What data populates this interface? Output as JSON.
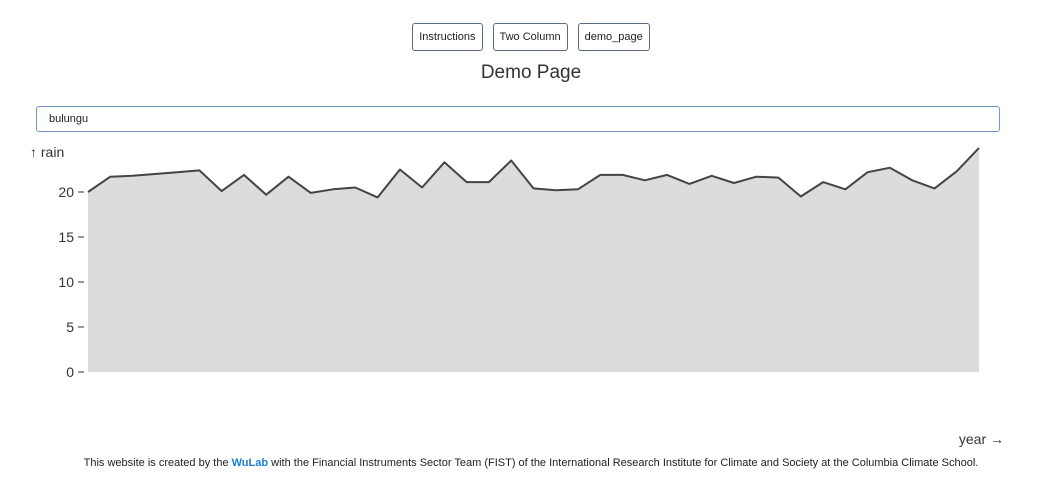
{
  "nav": {
    "items": [
      {
        "label": "Instructions"
      },
      {
        "label": "Two Column"
      },
      {
        "label": "demo_page"
      }
    ]
  },
  "page": {
    "title": "Demo Page"
  },
  "search": {
    "value": "bulungu"
  },
  "colors": {
    "area_fill": "#dcdcdc",
    "line": "#444444",
    "link": "#1a7fd6"
  },
  "chart_data": {
    "type": "area",
    "title": "",
    "ylabel": "↑ rain",
    "xlabel": "year →",
    "ylim": [
      0,
      25
    ],
    "yticks": [
      0,
      5,
      10,
      15,
      20
    ],
    "grid": false,
    "legend": "none",
    "series": [
      {
        "values": [
          20.0,
          21.7,
          21.8,
          22.0,
          22.2,
          22.4,
          20.1,
          21.9,
          19.7,
          21.7,
          19.9,
          20.3,
          20.5,
          19.4,
          22.5,
          20.5,
          23.3,
          21.1,
          21.1,
          23.5,
          20.4,
          20.2,
          20.3,
          21.9,
          21.9,
          21.3,
          21.9,
          20.9,
          21.8,
          21.0,
          21.7,
          21.6,
          19.5,
          21.1,
          20.3,
          22.2,
          22.7,
          21.3,
          20.4,
          22.3,
          24.9
        ]
      }
    ]
  },
  "footer": {
    "text_before": "This website is created by the ",
    "link_label": "WuLab",
    "text_after": " with the Financial Instruments Sector Team (FIST) of the International Research Institute for Climate and Society at the Columbia Climate School."
  }
}
